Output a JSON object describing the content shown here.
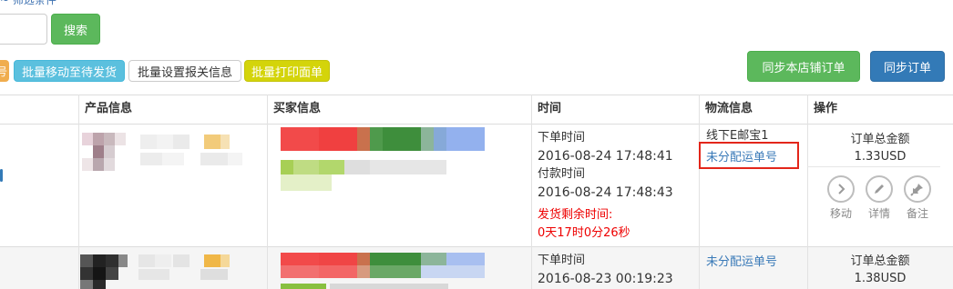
{
  "top_link": "~ 筛选条件",
  "toolbar": {
    "search_button": "搜索",
    "partial_button": "号",
    "move_button": "批量移动至待发货",
    "customs_button": "批量设置报关信息",
    "print_button": "批量打印面单",
    "sync_store_button": "同步本店铺订单",
    "sync_order_button": "同步订单"
  },
  "table": {
    "headers": [
      "产品信息",
      "买家信息",
      "时间",
      "物流信息",
      "操作"
    ],
    "rows": [
      {
        "order_time_label": "下单时间",
        "order_time": "2016-08-24 17:48:41",
        "pay_time_label": "付款时间",
        "pay_time": "2016-08-24 17:48:43",
        "remaining_label": "发货剩余时间:",
        "remaining_value": "0天17时0分26秒",
        "logistics_method": "线下E邮宝1",
        "logistics_status": "未分配运单号",
        "total_label": "订单总金额",
        "total_value": "1.33USD",
        "actions": [
          {
            "label": "移动",
            "icon": "chevron-right-icon"
          },
          {
            "label": "详情",
            "icon": "pencil-icon"
          },
          {
            "label": "备注",
            "icon": "pin-icon"
          }
        ]
      },
      {
        "order_time_label": "下单时间",
        "order_time": "2016-08-23 00:19:23",
        "logistics_status": "未分配运单号",
        "total_label": "订单总金额",
        "total_value": "1.38USD"
      }
    ]
  },
  "colors": {
    "success": "#5cb85c",
    "info": "#5bc0de",
    "primary": "#337ab7",
    "yellow": "#d4d40a",
    "highlight": "#e3261a",
    "danger": "#e00000"
  }
}
